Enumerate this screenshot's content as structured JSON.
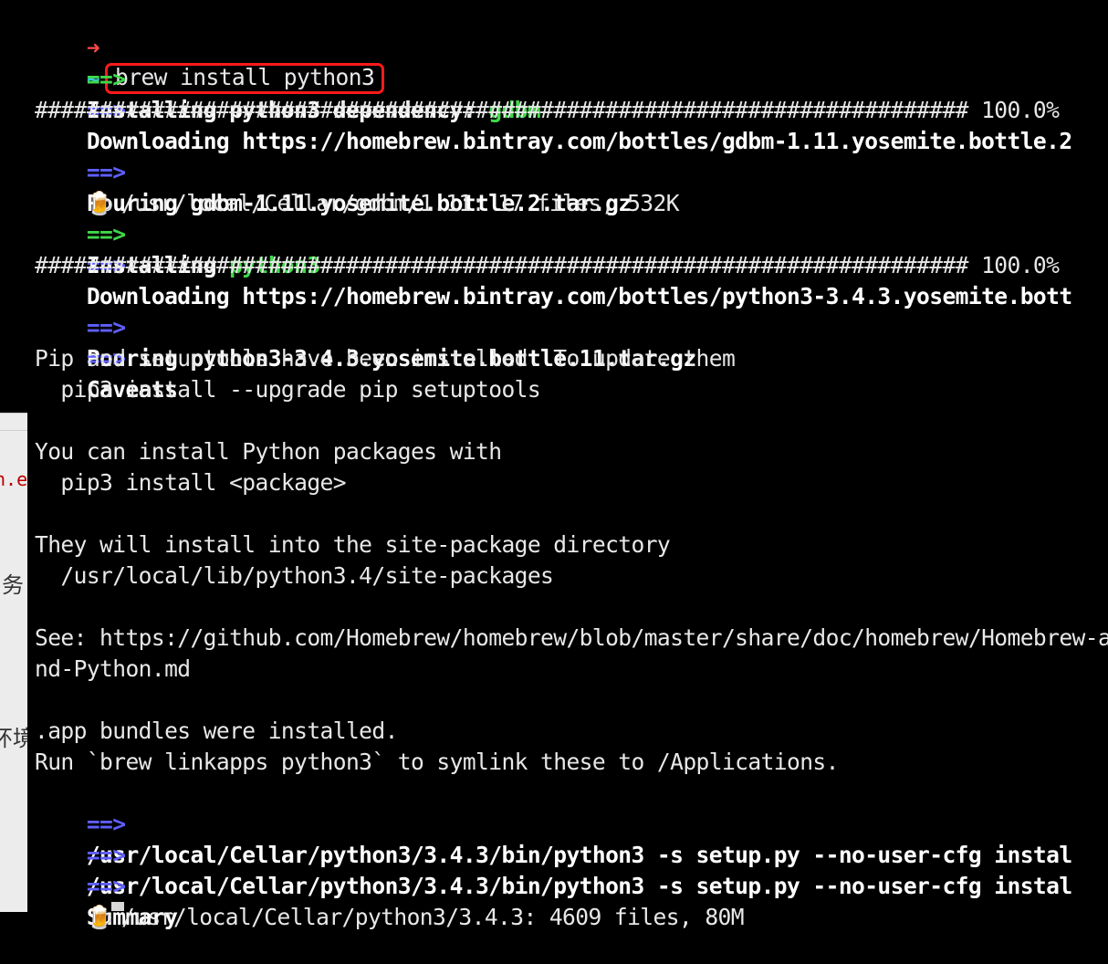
{
  "terminal": {
    "prompt": {
      "arrow": "➜",
      "dir": "~",
      "command": "brew install python3"
    },
    "arrow_glyph": "==>",
    "lines": {
      "l1_text": "Installing python3 dependency: ",
      "l1_highlight": "gdbm",
      "l2_text": "Downloading https://homebrew.bintray.com/bottles/gdbm-1.11.yosemite.bottle.2",
      "l3_progress": "######################################################################## 100.0%",
      "l4_text": "Pouring gdbm-1.11.yosemite.bottle.2.tar.gz",
      "l5_icon": "🍺",
      "l5_text": " /usr/local/Cellar/gdbm/1.11: 17 files, 532K",
      "l6_text": "Installing ",
      "l6_highlight": "python3",
      "l7_text": "Downloading https://homebrew.bintray.com/bottles/python3-3.4.3.yosemite.bott",
      "l8_progress": "######################################################################## 100.0%",
      "l9_text": "Pouring python3-3.4.3.yosemite.bottle.11.tar.gz",
      "l10_text": "Caveats",
      "l11": "Pip and setuptools have been installed. To update them",
      "l12": "  pip3 install --upgrade pip setuptools",
      "l14": "You can install Python packages with",
      "l15": "  pip3 install <package>",
      "l17": "They will install into the site-package directory",
      "l18": "  /usr/local/lib/python3.4/site-packages",
      "l20": "See: https://github.com/Homebrew/homebrew/blob/master/share/doc/homebrew/Homebrew-a",
      "l21": "nd-Python.md",
      "l23": ".app bundles were installed.",
      "l24": "Run `brew linkapps python3` to symlink these to /Applications.",
      "l25_text": "/usr/local/Cellar/python3/3.4.3/bin/python3 -s setup.py --no-user-cfg instal",
      "l26_text": "/usr/local/Cellar/python3/3.4.3/bin/python3 -s setup.py --no-user-cfg instal",
      "l27_text": "Summary",
      "l28_icon": "🍺",
      "l28_text": " /usr/local/Cellar/python3/3.4.3: 4609 files, 80M"
    }
  },
  "background_window": {
    "frag1": "n.e",
    "frag2": "务",
    "frag3": "环境"
  },
  "colors": {
    "background": "#000000",
    "text": "#e8e8e8",
    "green_arrow": "#3fd84a",
    "blue_arrow": "#5f5fff",
    "prompt_arrow": "#ff4a4a",
    "prompt_tilde": "#38c8d8",
    "highlight_box": "#ff1a1a"
  }
}
